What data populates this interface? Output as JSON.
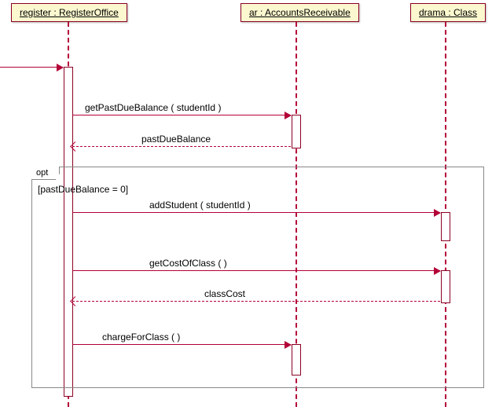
{
  "lifelines": {
    "register": {
      "label": "register : RegisterOffice"
    },
    "ar": {
      "label": "ar : AccountsReceivable"
    },
    "drama": {
      "label": "drama : Class"
    }
  },
  "fragment": {
    "operator": "opt",
    "guard": "[pastDueBalance = 0]"
  },
  "messages": {
    "m1": {
      "label": "getPastDueBalance ( studentId )"
    },
    "r1": {
      "label": "pastDueBalance"
    },
    "m2": {
      "label": "addStudent ( studentId )"
    },
    "m3": {
      "label": "getCostOfClass (   )"
    },
    "r3": {
      "label": "classCost"
    },
    "m4": {
      "label": "chargeForClass (   )"
    }
  },
  "chart_data": {
    "type": "table",
    "title": "UML sequence diagram — optional fragment",
    "lifelines": [
      {
        "id": "register",
        "name": "register",
        "class": "RegisterOffice"
      },
      {
        "id": "ar",
        "name": "ar",
        "class": "AccountsReceivable"
      },
      {
        "id": "drama",
        "name": "drama",
        "class": "Class"
      }
    ],
    "messages": [
      {
        "from": "register",
        "to": "ar",
        "type": "sync",
        "text": "getPastDueBalance ( studentId )"
      },
      {
        "from": "ar",
        "to": "register",
        "type": "return",
        "text": "pastDueBalance"
      }
    ],
    "fragments": [
      {
        "operator": "opt",
        "guard": "pastDueBalance = 0",
        "messages": [
          {
            "from": "register",
            "to": "drama",
            "type": "sync",
            "text": "addStudent ( studentId )"
          },
          {
            "from": "register",
            "to": "drama",
            "type": "sync",
            "text": "getCostOfClass (  )"
          },
          {
            "from": "drama",
            "to": "register",
            "type": "return",
            "text": "classCost"
          },
          {
            "from": "register",
            "to": "ar",
            "type": "sync",
            "text": "chargeForClass (  )"
          }
        ]
      }
    ]
  }
}
